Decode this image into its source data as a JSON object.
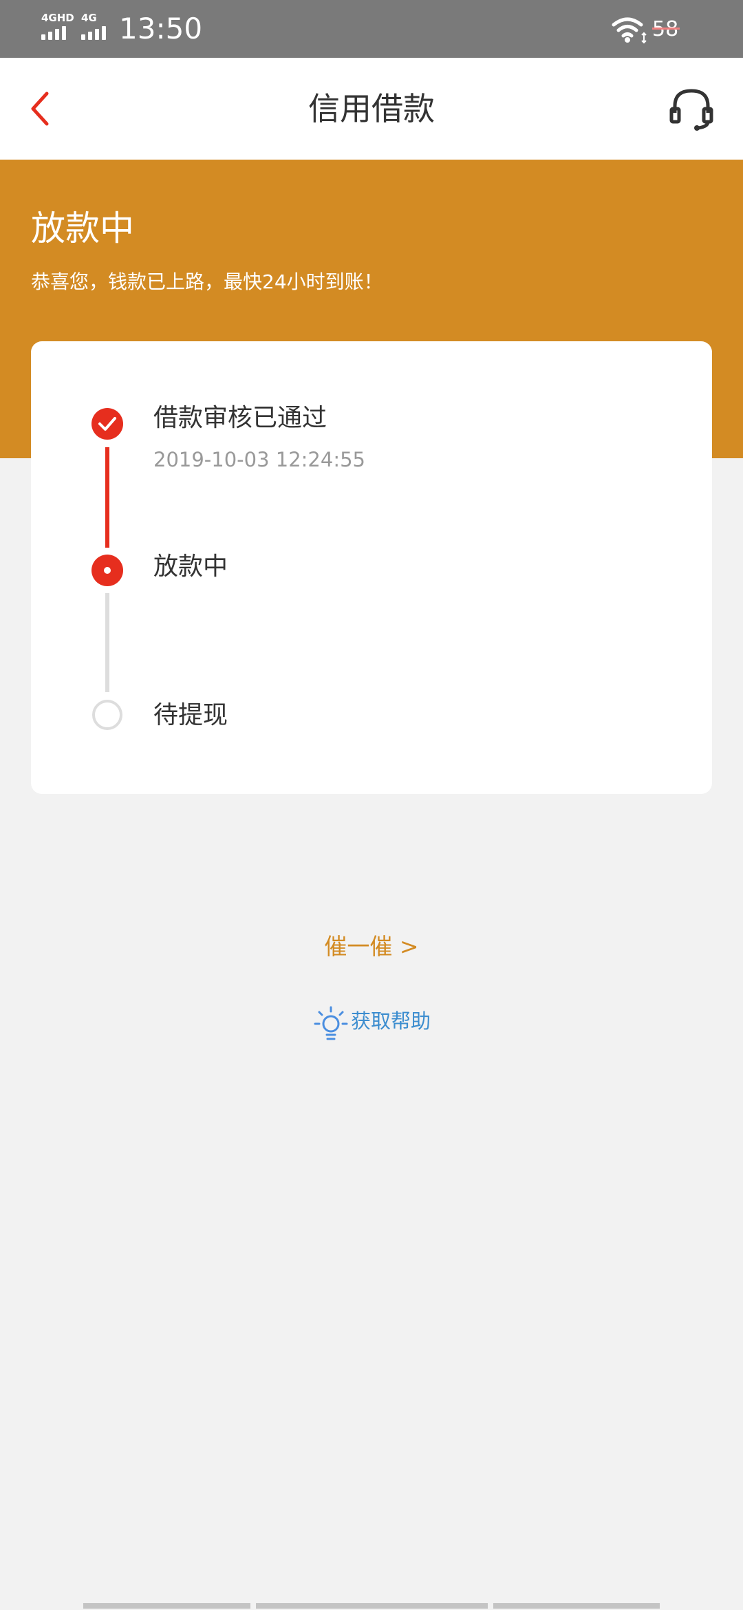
{
  "status_bar": {
    "network_1": "4GHD",
    "network_2": "4G",
    "time": "13:50",
    "battery": "58"
  },
  "header": {
    "title": "信用借款",
    "back_icon": "chevron-left-icon",
    "service_icon": "headset-icon"
  },
  "banner": {
    "title": "放款中",
    "subtitle": "恭喜您，钱款已上路，最快24小时到账！"
  },
  "progress": {
    "steps": [
      {
        "title": "借款审核已通过",
        "time": "2019-10-03 12:24:55",
        "state": "done"
      },
      {
        "title": "放款中",
        "time": "",
        "state": "current"
      },
      {
        "title": "待提现",
        "time": "",
        "state": "pending"
      }
    ]
  },
  "actions": {
    "urge_label": "催一催 >",
    "help_label": "获取帮助",
    "help_icon": "lightbulb-icon"
  },
  "colors": {
    "accent": "#d38b23",
    "primary_red": "#e62e1e",
    "help_blue": "#3c8dcf",
    "pending_gray": "#dddddd"
  }
}
